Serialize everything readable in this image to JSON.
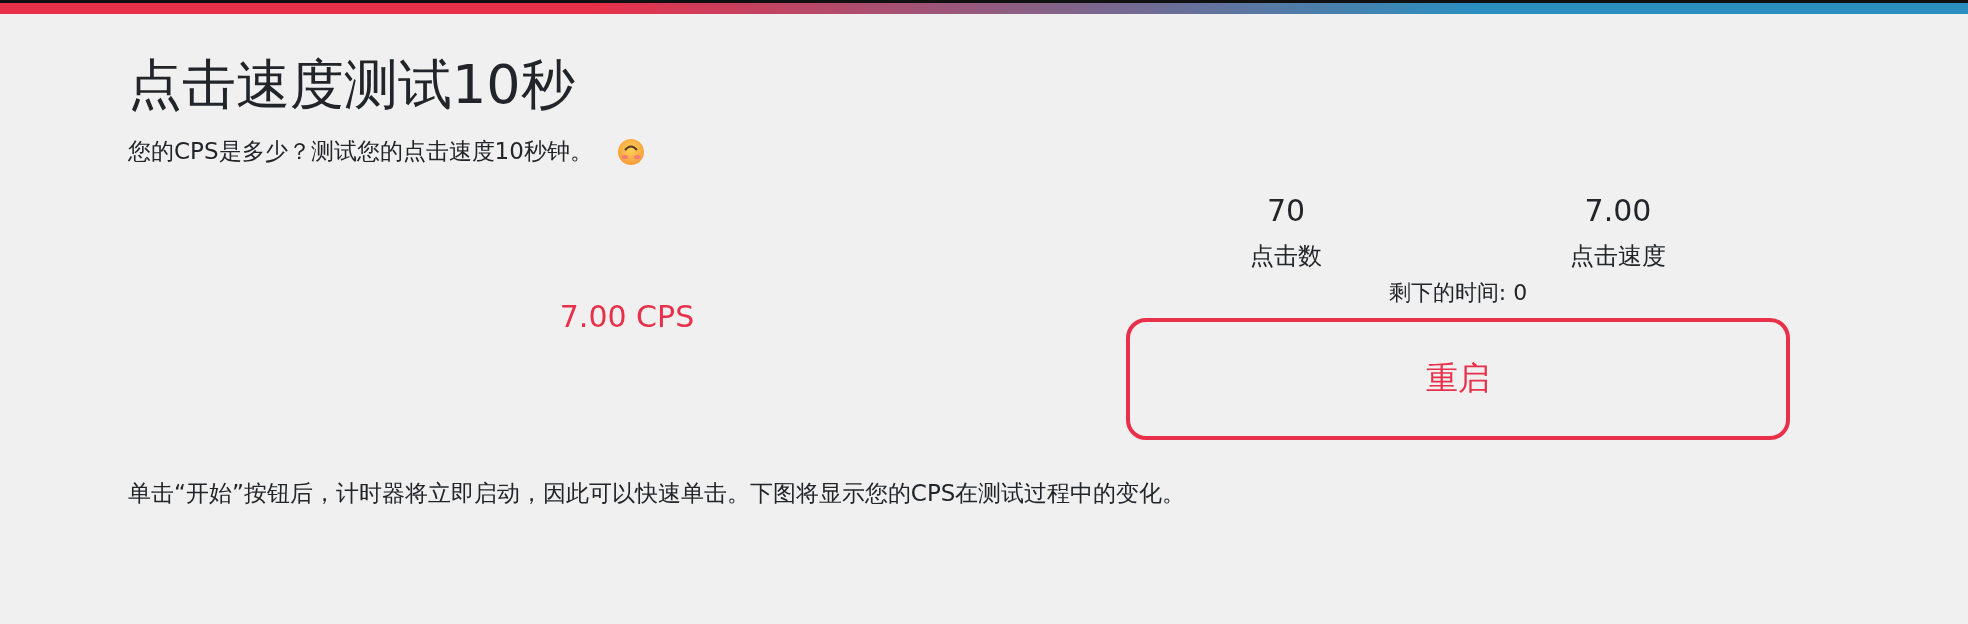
{
  "title": "点击速度测试10秒",
  "subtitle": "您的CPS是多少？测试您的点击速度10秒钟。",
  "result": "7.00 CPS",
  "stats": [
    {
      "value": "70",
      "label": "点击数"
    },
    {
      "value": "7.00",
      "label": "点击速度"
    }
  ],
  "time_left": "剩下的时间: 0",
  "restart_button": "重启",
  "description": "单击“开始”按钮后，计时器将立即启动，因此可以快速单击。下图将显示您的CPS在测试过程中的变化。"
}
